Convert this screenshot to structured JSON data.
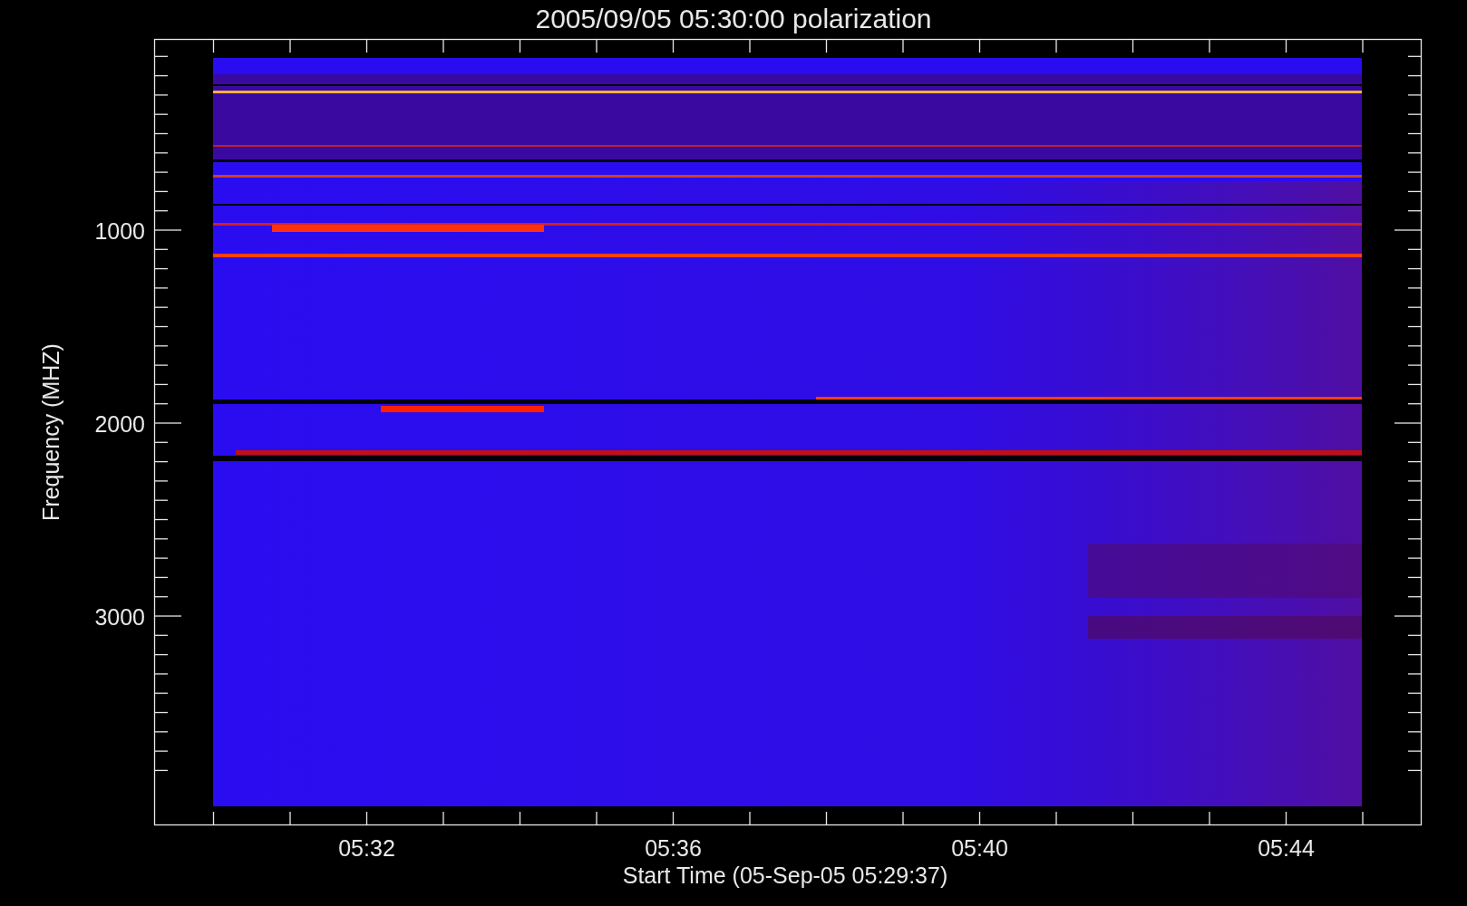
{
  "title": "2005/09/05 05:30:00 polarization",
  "plot": {
    "xlabel": "Start Time (05-Sep-05 05:29:37)",
    "ylabel": "Frequency (MHZ)",
    "xticks": [
      "05:32",
      "05:36",
      "05:40",
      "05:44"
    ],
    "yticks": [
      "1000",
      "2000",
      "3000"
    ]
  }
}
